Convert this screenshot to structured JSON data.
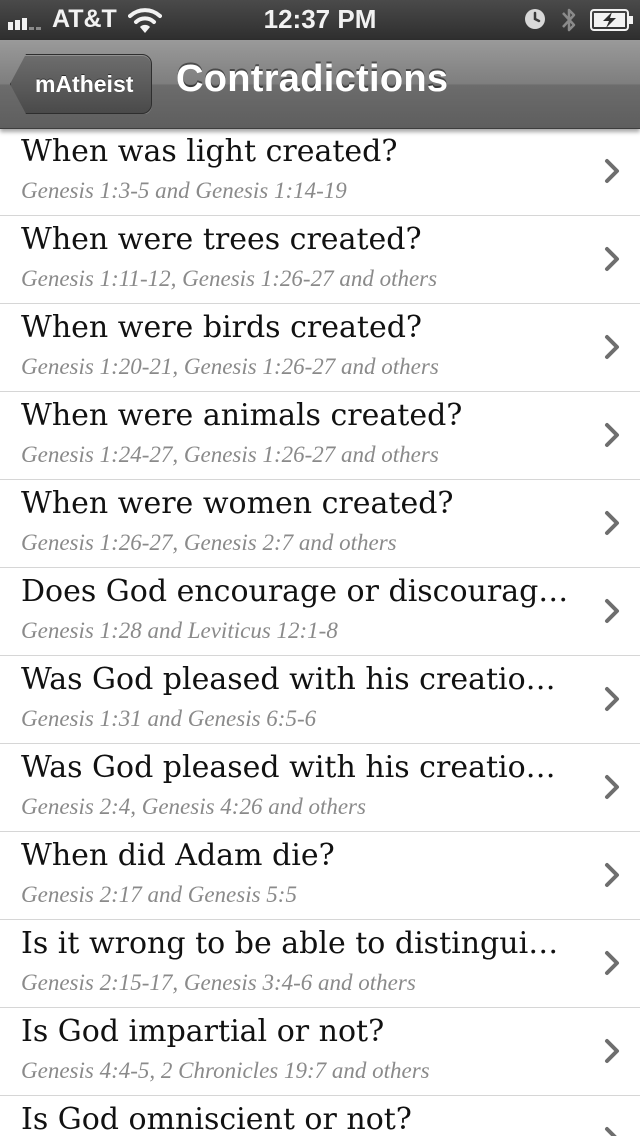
{
  "status_bar": {
    "carrier": "AT&T",
    "time": "12:37 PM",
    "icons": [
      "signal-icon",
      "wifi-icon",
      "alarm-icon",
      "bluetooth-icon",
      "battery-charging-icon"
    ]
  },
  "nav": {
    "back_label": "mAtheist",
    "title": "Contradictions"
  },
  "colors": {
    "nav_bar": "#7a7a7a",
    "title_text": "#111111",
    "subtitle_text": "#8a8a8a",
    "separator": "#d6d6d6",
    "chevron": "#6e6e6e"
  },
  "list": {
    "rows": [
      {
        "title": "When was light created?",
        "subtitle": "Genesis 1:3-5 and Genesis 1:14-19"
      },
      {
        "title": "When were trees created?",
        "subtitle": "Genesis 1:11-12, Genesis 1:26-27 and others"
      },
      {
        "title": "When were birds created?",
        "subtitle": "Genesis 1:20-21, Genesis 1:26-27 and others"
      },
      {
        "title": "When were animals created?",
        "subtitle": "Genesis 1:24-27, Genesis 1:26-27 and others"
      },
      {
        "title": "When were women created?",
        "subtitle": "Genesis 1:26-27, Genesis 2:7 and others"
      },
      {
        "title": "Does God encourage or discourage re...",
        "subtitle": "Genesis 1:28 and Leviticus 12:1-8"
      },
      {
        "title": "Was God pleased with his creation or...",
        "subtitle": "Genesis 1:31 and Genesis 6:5-6"
      },
      {
        "title": "Was God pleased with his creation or...",
        "subtitle": "Genesis 2:4, Genesis 4:26 and others"
      },
      {
        "title": "When did Adam die?",
        "subtitle": "Genesis 2:17 and Genesis 5:5"
      },
      {
        "title": "Is it wrong to be able to distinguish...",
        "subtitle": "Genesis 2:15-17, Genesis 3:4-6 and others"
      },
      {
        "title": "Is God impartial or not?",
        "subtitle": "Genesis 4:4-5, 2 Chronicles 19:7 and others"
      },
      {
        "title": "Is God omniscient or not?",
        "subtitle": ""
      }
    ]
  }
}
